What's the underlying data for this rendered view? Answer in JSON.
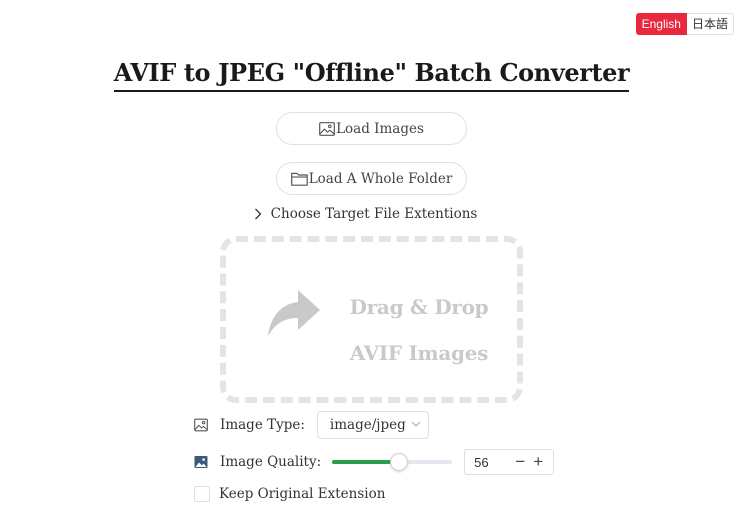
{
  "language": {
    "options": [
      "English",
      "日本語"
    ],
    "active": "English"
  },
  "header": {
    "title": "AVIF to JPEG \"Offline\" Batch Converter"
  },
  "actions": {
    "load_images_label": "Load Images",
    "load_folder_label": "Load A Whole Folder",
    "target_ext_label": "Choose Target File Extentions"
  },
  "dropzone": {
    "line1": "Drag & Drop",
    "line2": "AVIF Images"
  },
  "settings": {
    "image_type_label": "Image Type:",
    "image_type_value": "image/jpeg",
    "image_quality_label": "Image Quality:",
    "image_quality_value": "56",
    "image_quality_fraction": 0.56,
    "keep_extension_label": "Keep Original Extension",
    "keep_extension_checked": false
  },
  "colors": {
    "accent_red": "#e8283c",
    "slider_green": "#2a9d4a",
    "dropzone_gray": "#c9c9c9"
  },
  "icons": {
    "load_images": "image-icon",
    "load_folder": "folder-icon",
    "target_ext": "chevron-right-icon",
    "dropzone": "share-arrow-icon",
    "image_type": "image-icon",
    "image_quality": "image-filled-icon",
    "select_caret": "chevron-down-icon"
  }
}
